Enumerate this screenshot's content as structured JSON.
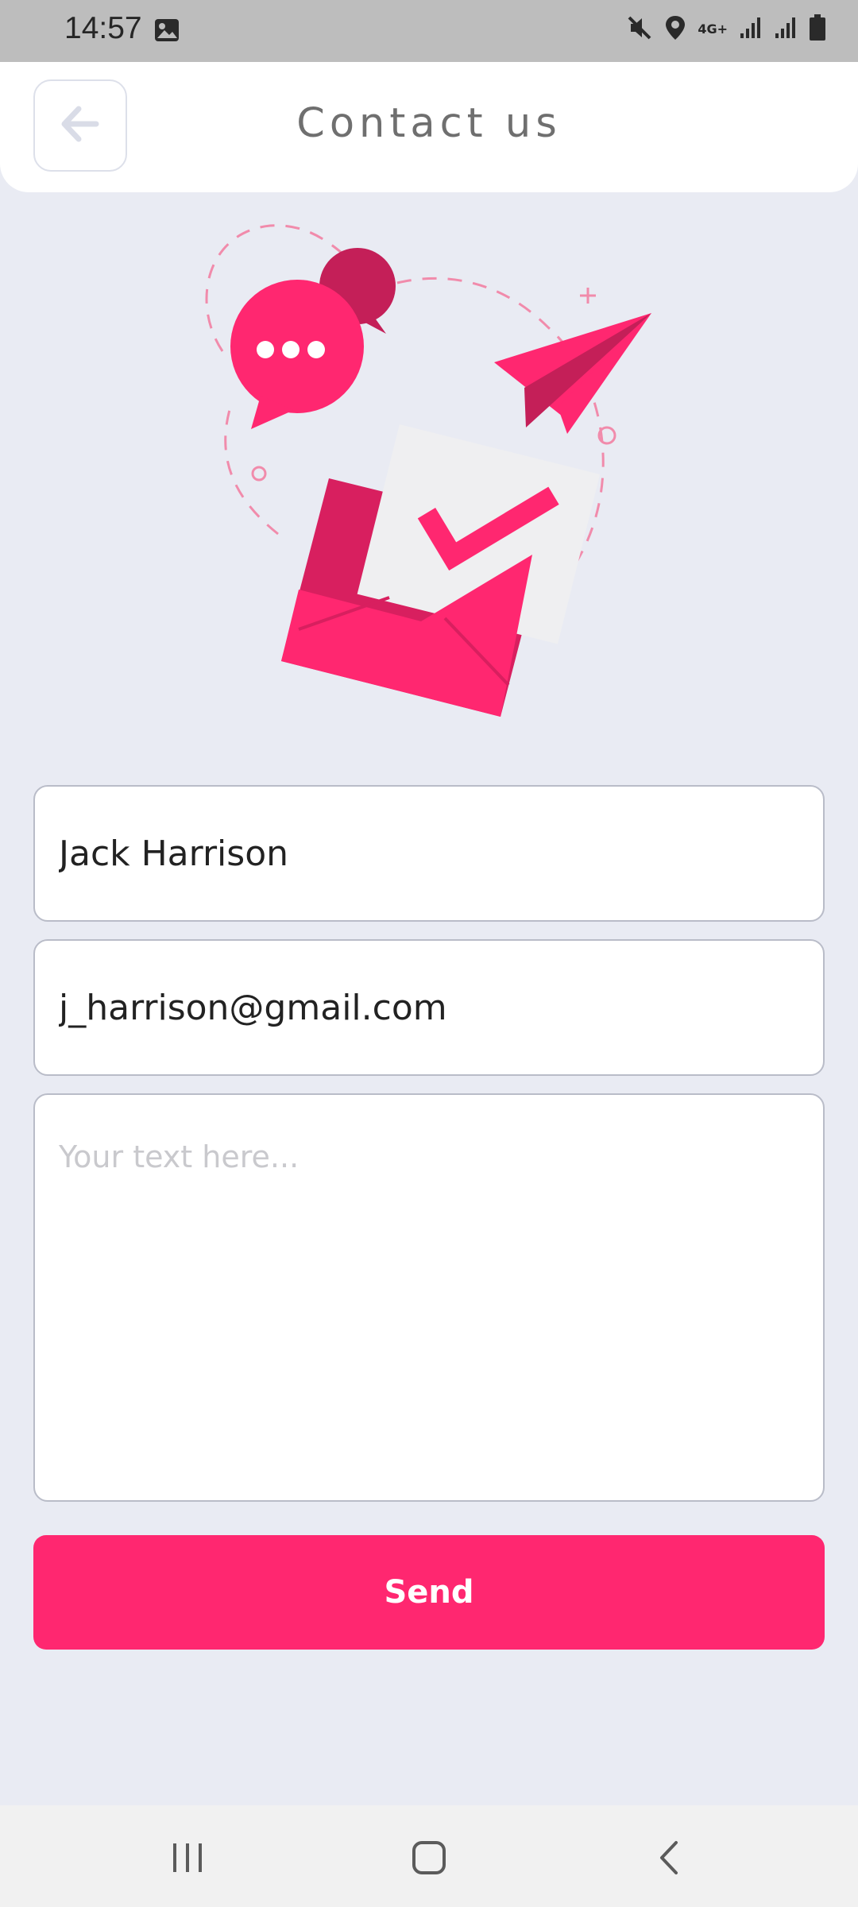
{
  "status_bar": {
    "time": "14:57",
    "network": "4G+",
    "icons": [
      "gallery-icon",
      "mute-icon",
      "location-icon",
      "signal-icon",
      "signal-icon",
      "battery-icon"
    ]
  },
  "header": {
    "title": "Contact us",
    "back_icon": "arrow-left-icon"
  },
  "illustration": {
    "description_icon": "envelope-checkmark-illustration",
    "accent": "#ff2770",
    "accent_dark": "#c41f58"
  },
  "form": {
    "name_value": "Jack Harrison",
    "email_value": "j_harrison@gmail.com",
    "message_value": "",
    "message_placeholder": "Your text here...",
    "send_label": "Send"
  },
  "nav_bar": {
    "icons": [
      "recent-apps-icon",
      "home-icon",
      "back-icon"
    ]
  },
  "colors": {
    "background": "#e9ebf3",
    "primary": "#ff2770",
    "input_border": "#b9bcc8",
    "title_text": "#6f6f6f"
  }
}
